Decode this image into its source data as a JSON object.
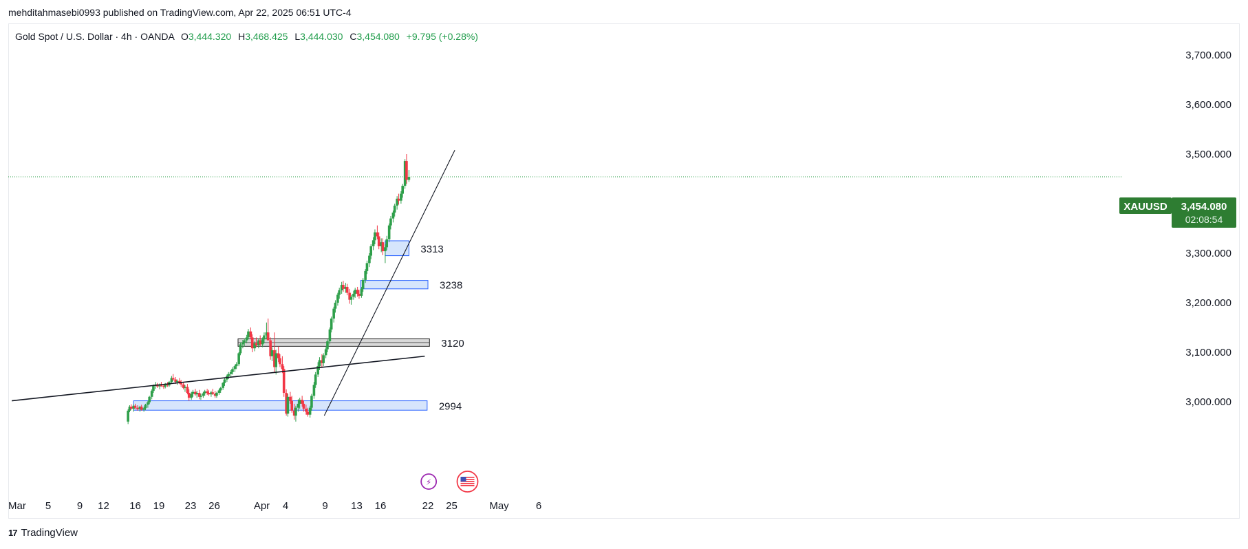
{
  "header": {
    "published_by": "mehditahmasebi0993 published on TradingView.com, Apr 22, 2025 06:51 UTC-4"
  },
  "legend": {
    "instrument": "Gold Spot / U.S. Dollar · 4h · OANDA",
    "open_label": "O",
    "open": "3,444.320",
    "high_label": "H",
    "high": "3,468.425",
    "low_label": "L",
    "low": "3,444.030",
    "close_label": "C",
    "close": "3,454.080",
    "change": "+9.795 (+0.28%)"
  },
  "price_badge": {
    "symbol": "XAUUSD",
    "price": "3,454.080",
    "countdown": "02:08:54"
  },
  "footer": {
    "brand": "TradingView",
    "logo_glyph": "17"
  },
  "colors": {
    "up": "#26a69a",
    "up_body": "#2e9f4a",
    "down": "#f23645",
    "accent_green": "#2e7d32",
    "zone_fill": "#cfe0fb",
    "zone_stroke": "#2962ff",
    "grey_zone": "#d6d6d6"
  },
  "chart_data": {
    "type": "candlestick",
    "timeframe": "4h",
    "y_range": [
      2940,
      3740
    ],
    "y_ticks": [
      "3,700.000",
      "3,600.000",
      "3,500.000",
      "3,400.000",
      "3,300.000",
      "3,200.000",
      "3,100.000",
      "3,000.000"
    ],
    "y_tick_values": [
      3700,
      3600,
      3500,
      3400,
      3300,
      3200,
      3100,
      3000
    ],
    "x_ticks": [
      {
        "label": "Mar",
        "day": 0
      },
      {
        "label": "5",
        "day": 4
      },
      {
        "label": "9",
        "day": 8
      },
      {
        "label": "12",
        "day": 11
      },
      {
        "label": "16",
        "day": 15
      },
      {
        "label": "19",
        "day": 18
      },
      {
        "label": "23",
        "day": 22
      },
      {
        "label": "26",
        "day": 25
      },
      {
        "label": "Apr",
        "day": 31
      },
      {
        "label": "4",
        "day": 34
      },
      {
        "label": "9",
        "day": 39
      },
      {
        "label": "13",
        "day": 43
      },
      {
        "label": "16",
        "day": 46
      },
      {
        "label": "22",
        "day": 52
      },
      {
        "label": "25",
        "day": 55
      },
      {
        "label": "May",
        "day": 61
      },
      {
        "label": "6",
        "day": 66
      }
    ],
    "zones": [
      {
        "label": "3313",
        "from_day": 46.6,
        "to_day": 49.6,
        "low": 3295,
        "high": 3325,
        "style": "blue"
      },
      {
        "label": "3238",
        "from_day": 43.5,
        "to_day": 52.0,
        "low": 3228,
        "high": 3245,
        "style": "blue"
      },
      {
        "label": "3120",
        "from_day": 28.0,
        "to_day": 52.2,
        "low": 3112,
        "high": 3127,
        "style": "grey"
      },
      {
        "label": "2994",
        "from_day": 14.8,
        "to_day": 51.9,
        "low": 2983,
        "high": 3002,
        "style": "blue"
      }
    ],
    "trendlines": [
      {
        "from": {
          "day": -0.6,
          "value": 3002
        },
        "to": {
          "day": 51.6,
          "value": 3092
        }
      },
      {
        "from": {
          "day": 38.9,
          "value": 2972
        },
        "to": {
          "day": 55.4,
          "value": 3508
        }
      }
    ],
    "last_price": 3454.08,
    "candles": [
      {
        "day": 14.1,
        "o": 2960,
        "h": 2985,
        "l": 2955,
        "c": 2982
      },
      {
        "day": 14.3,
        "o": 2982,
        "h": 2993,
        "l": 2979,
        "c": 2990
      },
      {
        "day": 14.5,
        "o": 2990,
        "h": 2995,
        "l": 2984,
        "c": 2986
      },
      {
        "day": 14.8,
        "o": 2986,
        "h": 2995,
        "l": 2980,
        "c": 2992
      },
      {
        "day": 15.0,
        "o": 2992,
        "h": 2996,
        "l": 2985,
        "c": 2988
      },
      {
        "day": 15.3,
        "o": 2988,
        "h": 2993,
        "l": 2982,
        "c": 2985
      },
      {
        "day": 15.6,
        "o": 2985,
        "h": 2992,
        "l": 2980,
        "c": 2990
      },
      {
        "day": 15.8,
        "o": 2990,
        "h": 2994,
        "l": 2982,
        "c": 2984
      },
      {
        "day": 16.1,
        "o": 2984,
        "h": 2990,
        "l": 2980,
        "c": 2987
      },
      {
        "day": 16.3,
        "o": 2987,
        "h": 2996,
        "l": 2983,
        "c": 2994
      },
      {
        "day": 16.6,
        "o": 2994,
        "h": 3002,
        "l": 2988,
        "c": 2999
      },
      {
        "day": 16.8,
        "o": 2999,
        "h": 3012,
        "l": 2995,
        "c": 3010
      },
      {
        "day": 17.1,
        "o": 3010,
        "h": 3025,
        "l": 3005,
        "c": 3022
      },
      {
        "day": 17.3,
        "o": 3022,
        "h": 3035,
        "l": 3018,
        "c": 3032
      },
      {
        "day": 17.6,
        "o": 3032,
        "h": 3040,
        "l": 3026,
        "c": 3035
      },
      {
        "day": 17.8,
        "o": 3035,
        "h": 3038,
        "l": 3028,
        "c": 3031
      },
      {
        "day": 18.1,
        "o": 3031,
        "h": 3037,
        "l": 3025,
        "c": 3034
      },
      {
        "day": 18.3,
        "o": 3034,
        "h": 3040,
        "l": 3030,
        "c": 3032
      },
      {
        "day": 18.6,
        "o": 3032,
        "h": 3036,
        "l": 3026,
        "c": 3030
      },
      {
        "day": 18.8,
        "o": 3030,
        "h": 3038,
        "l": 3027,
        "c": 3036
      },
      {
        "day": 19.1,
        "o": 3036,
        "h": 3040,
        "l": 3030,
        "c": 3033
      },
      {
        "day": 19.3,
        "o": 3033,
        "h": 3042,
        "l": 3030,
        "c": 3040
      },
      {
        "day": 19.6,
        "o": 3040,
        "h": 3052,
        "l": 3036,
        "c": 3048
      },
      {
        "day": 19.8,
        "o": 3048,
        "h": 3056,
        "l": 3042,
        "c": 3045
      },
      {
        "day": 20.1,
        "o": 3045,
        "h": 3050,
        "l": 3036,
        "c": 3040
      },
      {
        "day": 20.3,
        "o": 3040,
        "h": 3045,
        "l": 3034,
        "c": 3042
      },
      {
        "day": 20.6,
        "o": 3042,
        "h": 3048,
        "l": 3036,
        "c": 3038
      },
      {
        "day": 20.8,
        "o": 3038,
        "h": 3044,
        "l": 3030,
        "c": 3035
      },
      {
        "day": 21.1,
        "o": 3035,
        "h": 3040,
        "l": 3025,
        "c": 3028
      },
      {
        "day": 21.3,
        "o": 3028,
        "h": 3034,
        "l": 3020,
        "c": 3030
      },
      {
        "day": 21.6,
        "o": 3030,
        "h": 3036,
        "l": 3015,
        "c": 3018
      },
      {
        "day": 21.8,
        "o": 3018,
        "h": 3025,
        "l": 3002,
        "c": 3008
      },
      {
        "day": 22.1,
        "o": 3008,
        "h": 3020,
        "l": 3004,
        "c": 3016
      },
      {
        "day": 22.3,
        "o": 3016,
        "h": 3024,
        "l": 3010,
        "c": 3020
      },
      {
        "day": 22.6,
        "o": 3020,
        "h": 3026,
        "l": 3012,
        "c": 3015
      },
      {
        "day": 22.8,
        "o": 3015,
        "h": 3022,
        "l": 3008,
        "c": 3018
      },
      {
        "day": 23.1,
        "o": 3018,
        "h": 3024,
        "l": 3005,
        "c": 3010
      },
      {
        "day": 23.3,
        "o": 3010,
        "h": 3016,
        "l": 3004,
        "c": 3012
      },
      {
        "day": 23.6,
        "o": 3012,
        "h": 3020,
        "l": 3008,
        "c": 3017
      },
      {
        "day": 23.8,
        "o": 3017,
        "h": 3024,
        "l": 3012,
        "c": 3021
      },
      {
        "day": 24.1,
        "o": 3021,
        "h": 3026,
        "l": 3014,
        "c": 3018
      },
      {
        "day": 24.3,
        "o": 3018,
        "h": 3024,
        "l": 3012,
        "c": 3015
      },
      {
        "day": 24.6,
        "o": 3015,
        "h": 3022,
        "l": 3010,
        "c": 3019
      },
      {
        "day": 24.8,
        "o": 3019,
        "h": 3026,
        "l": 3014,
        "c": 3016
      },
      {
        "day": 25.1,
        "o": 3016,
        "h": 3022,
        "l": 3008,
        "c": 3012
      },
      {
        "day": 25.3,
        "o": 3012,
        "h": 3020,
        "l": 3008,
        "c": 3018
      },
      {
        "day": 25.6,
        "o": 3018,
        "h": 3026,
        "l": 3014,
        "c": 3023
      },
      {
        "day": 25.8,
        "o": 3023,
        "h": 3030,
        "l": 3018,
        "c": 3028
      },
      {
        "day": 26.1,
        "o": 3028,
        "h": 3040,
        "l": 3024,
        "c": 3038
      },
      {
        "day": 26.3,
        "o": 3038,
        "h": 3048,
        "l": 3032,
        "c": 3045
      },
      {
        "day": 26.6,
        "o": 3045,
        "h": 3055,
        "l": 3040,
        "c": 3052
      },
      {
        "day": 26.8,
        "o": 3052,
        "h": 3060,
        "l": 3046,
        "c": 3056
      },
      {
        "day": 27.1,
        "o": 3056,
        "h": 3064,
        "l": 3050,
        "c": 3060
      },
      {
        "day": 27.3,
        "o": 3060,
        "h": 3070,
        "l": 3055,
        "c": 3066
      },
      {
        "day": 27.6,
        "o": 3066,
        "h": 3075,
        "l": 3060,
        "c": 3072
      },
      {
        "day": 27.8,
        "o": 3072,
        "h": 3080,
        "l": 3066,
        "c": 3076
      },
      {
        "day": 28.1,
        "o": 3076,
        "h": 3100,
        "l": 3072,
        "c": 3098
      },
      {
        "day": 28.3,
        "o": 3098,
        "h": 3120,
        "l": 3094,
        "c": 3116
      },
      {
        "day": 28.6,
        "o": 3116,
        "h": 3125,
        "l": 3108,
        "c": 3120
      },
      {
        "day": 28.8,
        "o": 3120,
        "h": 3128,
        "l": 3112,
        "c": 3124
      },
      {
        "day": 29.1,
        "o": 3124,
        "h": 3135,
        "l": 3118,
        "c": 3130
      },
      {
        "day": 29.3,
        "o": 3130,
        "h": 3147,
        "l": 3126,
        "c": 3142
      },
      {
        "day": 29.6,
        "o": 3142,
        "h": 3150,
        "l": 3126,
        "c": 3130
      },
      {
        "day": 29.8,
        "o": 3130,
        "h": 3136,
        "l": 3100,
        "c": 3108
      },
      {
        "day": 30.1,
        "o": 3108,
        "h": 3122,
        "l": 3102,
        "c": 3118
      },
      {
        "day": 30.3,
        "o": 3118,
        "h": 3130,
        "l": 3110,
        "c": 3114
      },
      {
        "day": 30.6,
        "o": 3114,
        "h": 3128,
        "l": 3108,
        "c": 3124
      },
      {
        "day": 30.8,
        "o": 3124,
        "h": 3134,
        "l": 3112,
        "c": 3116
      },
      {
        "day": 31.1,
        "o": 3116,
        "h": 3130,
        "l": 3110,
        "c": 3126
      },
      {
        "day": 31.3,
        "o": 3126,
        "h": 3140,
        "l": 3118,
        "c": 3134
      },
      {
        "day": 31.6,
        "o": 3134,
        "h": 3160,
        "l": 3126,
        "c": 3140
      },
      {
        "day": 31.8,
        "o": 3140,
        "h": 3168,
        "l": 3130,
        "c": 3124
      },
      {
        "day": 32.1,
        "o": 3124,
        "h": 3130,
        "l": 3085,
        "c": 3092
      },
      {
        "day": 32.3,
        "o": 3092,
        "h": 3110,
        "l": 3082,
        "c": 3104
      },
      {
        "day": 32.6,
        "o": 3104,
        "h": 3140,
        "l": 3060,
        "c": 3070
      },
      {
        "day": 32.8,
        "o": 3070,
        "h": 3105,
        "l": 3055,
        "c": 3098
      },
      {
        "day": 33.1,
        "o": 3098,
        "h": 3112,
        "l": 3080,
        "c": 3088
      },
      {
        "day": 33.3,
        "o": 3088,
        "h": 3096,
        "l": 3070,
        "c": 3076
      },
      {
        "day": 33.6,
        "o": 3076,
        "h": 3092,
        "l": 3058,
        "c": 3066
      },
      {
        "day": 33.8,
        "o": 3066,
        "h": 3072,
        "l": 3010,
        "c": 3018
      },
      {
        "day": 34.1,
        "o": 3018,
        "h": 3025,
        "l": 2972,
        "c": 2976
      },
      {
        "day": 34.3,
        "o": 2976,
        "h": 3016,
        "l": 2970,
        "c": 3010
      },
      {
        "day": 34.6,
        "o": 3010,
        "h": 3020,
        "l": 2996,
        "c": 3002
      },
      {
        "day": 34.8,
        "o": 3002,
        "h": 3012,
        "l": 2978,
        "c": 2982
      },
      {
        "day": 35.1,
        "o": 2982,
        "h": 2996,
        "l": 2964,
        "c": 2972
      },
      {
        "day": 35.3,
        "o": 2972,
        "h": 2992,
        "l": 2960,
        "c": 2988
      },
      {
        "day": 35.6,
        "o": 2988,
        "h": 3005,
        "l": 2980,
        "c": 2996
      },
      {
        "day": 35.8,
        "o": 2996,
        "h": 3008,
        "l": 2986,
        "c": 3004
      },
      {
        "day": 36.1,
        "o": 3004,
        "h": 3012,
        "l": 2990,
        "c": 2996
      },
      {
        "day": 36.3,
        "o": 2996,
        "h": 3002,
        "l": 2980,
        "c": 2986
      },
      {
        "day": 36.6,
        "o": 2986,
        "h": 2994,
        "l": 2974,
        "c": 2980
      },
      {
        "day": 36.8,
        "o": 2980,
        "h": 2988,
        "l": 2970,
        "c": 2974
      },
      {
        "day": 37.1,
        "o": 2974,
        "h": 2992,
        "l": 2968,
        "c": 2988
      },
      {
        "day": 37.3,
        "o": 2988,
        "h": 3016,
        "l": 2982,
        "c": 3012
      },
      {
        "day": 37.6,
        "o": 3012,
        "h": 3040,
        "l": 3006,
        "c": 3034
      },
      {
        "day": 37.8,
        "o": 3034,
        "h": 3060,
        "l": 3028,
        "c": 3055
      },
      {
        "day": 38.1,
        "o": 3055,
        "h": 3080,
        "l": 3050,
        "c": 3072
      },
      {
        "day": 38.3,
        "o": 3072,
        "h": 3090,
        "l": 3064,
        "c": 3084
      },
      {
        "day": 38.6,
        "o": 3084,
        "h": 3096,
        "l": 3070,
        "c": 3078
      },
      {
        "day": 38.8,
        "o": 3078,
        "h": 3098,
        "l": 3072,
        "c": 3094
      },
      {
        "day": 39.1,
        "o": 3094,
        "h": 3110,
        "l": 3088,
        "c": 3106
      },
      {
        "day": 39.3,
        "o": 3106,
        "h": 3126,
        "l": 3100,
        "c": 3122
      },
      {
        "day": 39.6,
        "o": 3122,
        "h": 3150,
        "l": 3116,
        "c": 3146
      },
      {
        "day": 39.8,
        "o": 3146,
        "h": 3172,
        "l": 3140,
        "c": 3168
      },
      {
        "day": 40.1,
        "o": 3168,
        "h": 3192,
        "l": 3160,
        "c": 3188
      },
      {
        "day": 40.3,
        "o": 3188,
        "h": 3205,
        "l": 3180,
        "c": 3200
      },
      {
        "day": 40.6,
        "o": 3200,
        "h": 3220,
        "l": 3194,
        "c": 3216
      },
      {
        "day": 40.8,
        "o": 3216,
        "h": 3230,
        "l": 3208,
        "c": 3225
      },
      {
        "day": 41.1,
        "o": 3225,
        "h": 3242,
        "l": 3218,
        "c": 3236
      },
      {
        "day": 41.3,
        "o": 3236,
        "h": 3244,
        "l": 3222,
        "c": 3228
      },
      {
        "day": 41.6,
        "o": 3228,
        "h": 3240,
        "l": 3220,
        "c": 3232
      },
      {
        "day": 41.8,
        "o": 3232,
        "h": 3238,
        "l": 3215,
        "c": 3220
      },
      {
        "day": 42.1,
        "o": 3220,
        "h": 3228,
        "l": 3198,
        "c": 3206
      },
      {
        "day": 42.3,
        "o": 3206,
        "h": 3216,
        "l": 3196,
        "c": 3212
      },
      {
        "day": 42.6,
        "o": 3212,
        "h": 3224,
        "l": 3206,
        "c": 3218
      },
      {
        "day": 42.8,
        "o": 3218,
        "h": 3230,
        "l": 3210,
        "c": 3226
      },
      {
        "day": 43.1,
        "o": 3226,
        "h": 3232,
        "l": 3212,
        "c": 3218
      },
      {
        "day": 43.3,
        "o": 3218,
        "h": 3226,
        "l": 3208,
        "c": 3214
      },
      {
        "day": 43.6,
        "o": 3214,
        "h": 3232,
        "l": 3210,
        "c": 3228
      },
      {
        "day": 43.8,
        "o": 3228,
        "h": 3250,
        "l": 3222,
        "c": 3246
      },
      {
        "day": 44.1,
        "o": 3246,
        "h": 3268,
        "l": 3240,
        "c": 3264
      },
      {
        "day": 44.3,
        "o": 3264,
        "h": 3285,
        "l": 3258,
        "c": 3280
      },
      {
        "day": 44.6,
        "o": 3280,
        "h": 3300,
        "l": 3272,
        "c": 3295
      },
      {
        "day": 44.8,
        "o": 3295,
        "h": 3318,
        "l": 3288,
        "c": 3314
      },
      {
        "day": 45.1,
        "o": 3314,
        "h": 3332,
        "l": 3306,
        "c": 3326
      },
      {
        "day": 45.3,
        "o": 3326,
        "h": 3348,
        "l": 3318,
        "c": 3342
      },
      {
        "day": 45.6,
        "o": 3342,
        "h": 3356,
        "l": 3328,
        "c": 3334
      },
      {
        "day": 45.8,
        "o": 3334,
        "h": 3342,
        "l": 3308,
        "c": 3314
      },
      {
        "day": 46.1,
        "o": 3314,
        "h": 3330,
        "l": 3302,
        "c": 3322
      },
      {
        "day": 46.3,
        "o": 3322,
        "h": 3330,
        "l": 3296,
        "c": 3304
      },
      {
        "day": 46.6,
        "o": 3304,
        "h": 3318,
        "l": 3280,
        "c": 3312
      },
      {
        "day": 46.8,
        "o": 3312,
        "h": 3335,
        "l": 3306,
        "c": 3328
      },
      {
        "day": 47.1,
        "o": 3328,
        "h": 3360,
        "l": 3322,
        "c": 3356
      },
      {
        "day": 47.3,
        "o": 3356,
        "h": 3375,
        "l": 3348,
        "c": 3370
      },
      {
        "day": 47.6,
        "o": 3370,
        "h": 3386,
        "l": 3362,
        "c": 3382
      },
      {
        "day": 47.8,
        "o": 3382,
        "h": 3400,
        "l": 3374,
        "c": 3396
      },
      {
        "day": 48.1,
        "o": 3396,
        "h": 3415,
        "l": 3388,
        "c": 3410
      },
      {
        "day": 48.3,
        "o": 3410,
        "h": 3420,
        "l": 3398,
        "c": 3406
      },
      {
        "day": 48.6,
        "o": 3406,
        "h": 3425,
        "l": 3400,
        "c": 3420
      },
      {
        "day": 48.8,
        "o": 3420,
        "h": 3440,
        "l": 3412,
        "c": 3436
      },
      {
        "day": 49.1,
        "o": 3436,
        "h": 3490,
        "l": 3430,
        "c": 3486
      },
      {
        "day": 49.3,
        "o": 3486,
        "h": 3500,
        "l": 3440,
        "c": 3448
      },
      {
        "day": 49.6,
        "o": 3448,
        "h": 3468,
        "l": 3444,
        "c": 3454
      }
    ]
  },
  "annotation_icons": [
    {
      "name": "lightning-event-icon",
      "glyph": "⚡"
    },
    {
      "name": "us-flag-event-icon",
      "glyph": "🇺🇸"
    }
  ]
}
